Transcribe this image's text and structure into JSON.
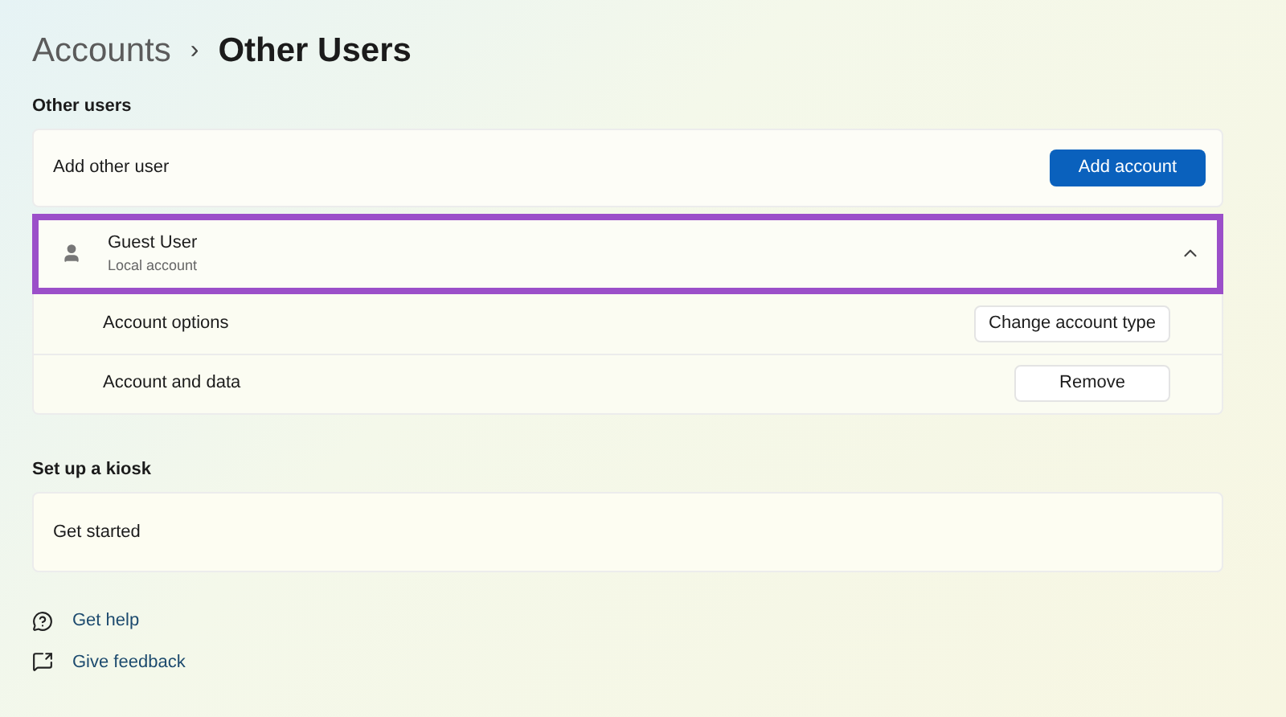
{
  "breadcrumb": {
    "parent": "Accounts",
    "separator": "›",
    "current": "Other Users"
  },
  "other_users": {
    "heading": "Other users",
    "add_row": {
      "label": "Add other user",
      "button": "Add account"
    },
    "user": {
      "name": "Guest User",
      "subtitle": "Local account",
      "expanded": true,
      "highlighted": true,
      "options": [
        {
          "label": "Account options",
          "button": "Change account type"
        },
        {
          "label": "Account and data",
          "button": "Remove"
        }
      ]
    }
  },
  "kiosk": {
    "heading": "Set up a kiosk",
    "row": "Get started"
  },
  "links": [
    {
      "kind": "help",
      "label": "Get help"
    },
    {
      "kind": "feedback",
      "label": "Give feedback"
    }
  ]
}
